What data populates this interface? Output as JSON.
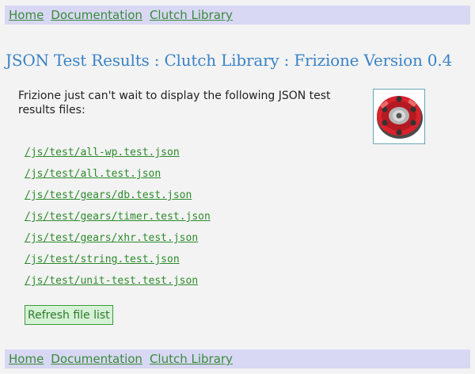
{
  "nav": {
    "home": "Home",
    "documentation": "Documentation",
    "library": "Clutch Library"
  },
  "page": {
    "title": "JSON Test Results : Clutch Library : Frizione Version 0.4",
    "intro": "Frizione just can't wait to display the following JSON test results files:"
  },
  "logo": {
    "icon": "clutch-logo-icon"
  },
  "files": [
    "/js/test/all-wp.test.json",
    "/js/test/all.test.json",
    "/js/test/gears/db.test.json",
    "/js/test/gears/timer.test.json",
    "/js/test/gears/xhr.test.json",
    "/js/test/string.test.json",
    "/js/test/unit-test.test.json"
  ],
  "refresh_button": "Refresh file list",
  "colors": {
    "nav_background": "#d8d8f4",
    "link": "#3a8a3a",
    "title": "#3b83c6",
    "button_background": "#d6f2d6",
    "page_background": "#f3f3f3"
  }
}
